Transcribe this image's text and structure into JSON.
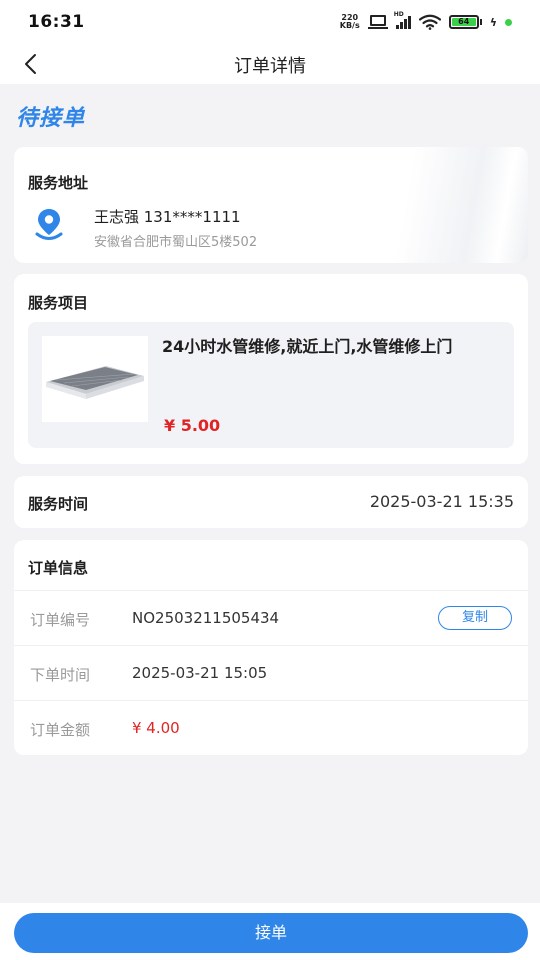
{
  "status_bar": {
    "time": "16:31",
    "net_speed_value": "220",
    "net_speed_unit": "KB/s",
    "signal_label": "HD",
    "battery_level": "64",
    "icons": [
      "laptop-icon",
      "signal-icon",
      "wifi-icon",
      "battery-icon",
      "charging-bolt-icon"
    ]
  },
  "nav": {
    "title": "订单详情",
    "back_icon": "chevron-left-icon"
  },
  "order_status": "待接单",
  "address": {
    "title": "服务地址",
    "name_phone": "王志强 131****1111",
    "detail": "安徽省合肥市蜀山区5楼502",
    "icon": "location-pin-icon"
  },
  "service": {
    "title": "服务项目",
    "item_name": "24小时水管维修,就近上门,水管维修上门",
    "price": "¥ 5.00"
  },
  "service_time": {
    "label": "服务时间",
    "value": "2025-03-21 15:35"
  },
  "order_info": {
    "title": "订单信息",
    "rows": [
      {
        "label": "订单编号",
        "value": "NO2503211505434"
      },
      {
        "label": "下单时间",
        "value": "2025-03-21 15:05"
      },
      {
        "label": "订单金额",
        "value": "¥ 4.00"
      }
    ],
    "copy_label": "复制"
  },
  "bottom": {
    "accept_label": "接单"
  },
  "colors": {
    "accent": "#2f86e8",
    "price_red": "#e02424",
    "background": "#f3f3f5"
  }
}
